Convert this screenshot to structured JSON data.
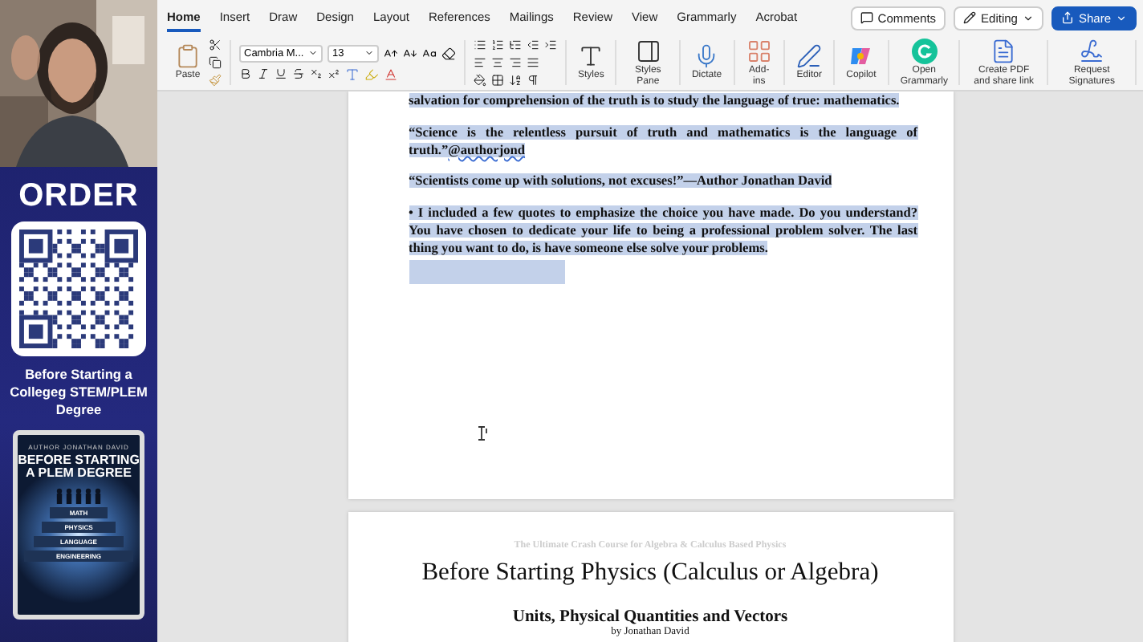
{
  "promo": {
    "heading": "ORDER",
    "caption": "Before Starting a Collegeg STEM/PLEM Degree",
    "book": {
      "author": "AUTHOR JONATHAN DAVID",
      "title": "BEFORE STARTING A PLEM DEGREE",
      "steps": [
        "MATH",
        "PHYSICS",
        "LANGUAGE",
        "ENGINEERING"
      ]
    }
  },
  "ribbon": {
    "tabs": [
      {
        "label": "Home",
        "selected": true
      },
      {
        "label": "Insert",
        "selected": false
      },
      {
        "label": "Draw",
        "selected": false
      },
      {
        "label": "Design",
        "selected": false
      },
      {
        "label": "Layout",
        "selected": false
      },
      {
        "label": "References",
        "selected": false
      },
      {
        "label": "Mailings",
        "selected": false
      },
      {
        "label": "Review",
        "selected": false
      },
      {
        "label": "View",
        "selected": false
      },
      {
        "label": "Grammarly",
        "selected": false
      },
      {
        "label": "Acrobat",
        "selected": false
      }
    ],
    "actions": [
      {
        "kind": "comments",
        "label": "Comments"
      },
      {
        "kind": "editing",
        "label": "Editing"
      },
      {
        "kind": "share",
        "label": "Share"
      }
    ],
    "font": {
      "name": "Cambria M...",
      "size": "13"
    },
    "paste": "Paste",
    "tools": [
      {
        "kind": "styles",
        "label": "Styles"
      },
      {
        "kind": "pane",
        "label": "Styles Pane"
      },
      {
        "kind": "dictate",
        "label": "Dictate"
      },
      {
        "kind": "addins",
        "label": "Add-ins"
      },
      {
        "kind": "editor",
        "label": "Editor"
      },
      {
        "kind": "copilot",
        "label": "Copilot"
      },
      {
        "kind": "grammarly",
        "label": "Open Grammarly"
      },
      {
        "kind": "pdf",
        "label": "Create PDF and share link"
      },
      {
        "kind": "sign",
        "label": "Request Signatures"
      }
    ]
  },
  "document": {
    "page1": {
      "paragraphs": [
        {
          "text": "salvation for comprehension of the truth is to study the language of true: mathematics.",
          "selected": true
        },
        {
          "text": "“Science is the relentless pursuit of truth and mathematics is the language of truth.”",
          "flagged": "@authorjond",
          "selected": true
        },
        {
          "text": "“Scientists come up with solutions, not excuses!”—Author Jonathan David",
          "selected": true
        },
        {
          "text": "• I included a few quotes to emphasize the choice you have made. Do you understand? You have chosen to dedicate your life to being a professional problem solver. The last thing you want to do, is have someone else solve your problems.",
          "selected": true
        }
      ]
    },
    "page2": {
      "kicker": "The Ultimate Crash Course for Algebra & Calculus Based Physics",
      "title": "Before Starting Physics (Calculus or Algebra)",
      "subtitle": "Units, Physical Quantities and Vectors",
      "byline": "by Jonathan David"
    }
  }
}
